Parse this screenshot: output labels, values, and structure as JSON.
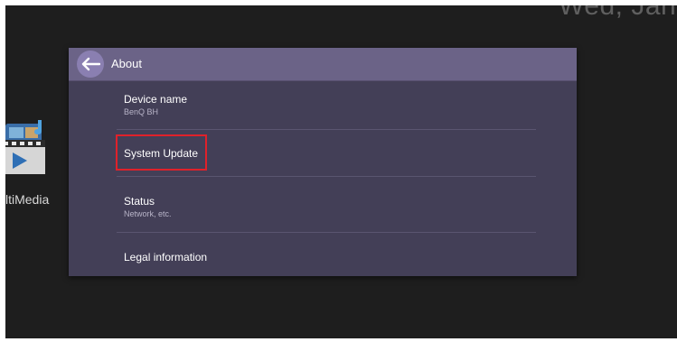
{
  "status_bar": {
    "clock_text": "Wed, Janua"
  },
  "desktop": {
    "app_label": "ltiMedia"
  },
  "dialog": {
    "title": "About",
    "items": [
      {
        "title": "Device name",
        "subtitle": "BenQ BH"
      },
      {
        "title": "System Update",
        "subtitle": ""
      },
      {
        "title": "Status",
        "subtitle": "Network, etc."
      },
      {
        "title": "Legal information",
        "subtitle": ""
      }
    ]
  },
  "colors": {
    "header": "#6b6387",
    "dialog_bg": "#433f57",
    "back_button": "#8a7fb1",
    "highlight": "#e0212a"
  },
  "icons": {
    "back": "arrow-left-icon",
    "app": "multimedia-icon"
  }
}
